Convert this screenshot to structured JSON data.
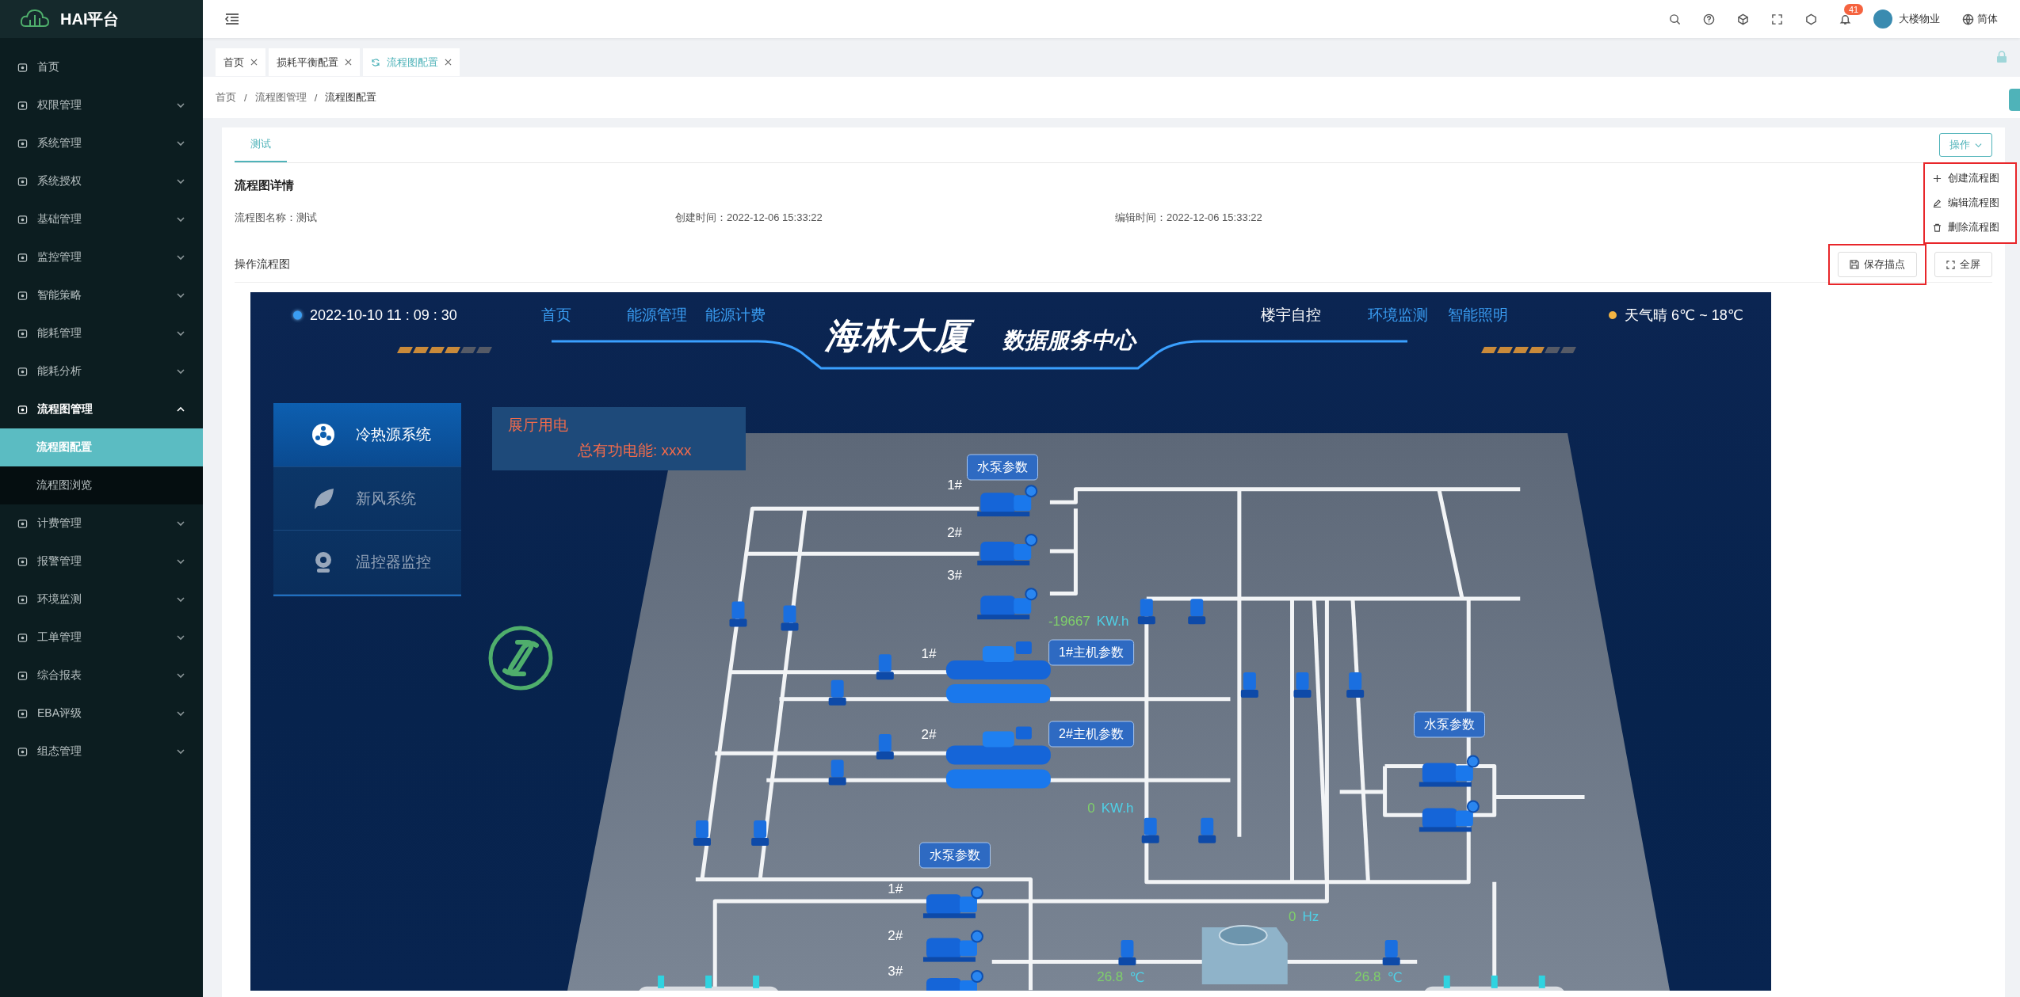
{
  "sidebar": {
    "logo": "HAI平台",
    "items": [
      {
        "label": "首页",
        "kind": "link"
      },
      {
        "label": "权限管理",
        "kind": "group",
        "expanded": false
      },
      {
        "label": "系统管理",
        "kind": "group",
        "expanded": false
      },
      {
        "label": "系统授权",
        "kind": "group",
        "expanded": false
      },
      {
        "label": "基础管理",
        "kind": "group",
        "expanded": false
      },
      {
        "label": "监控管理",
        "kind": "group",
        "expanded": false
      },
      {
        "label": "智能策略",
        "kind": "group",
        "expanded": false
      },
      {
        "label": "能耗管理",
        "kind": "group",
        "expanded": false
      },
      {
        "label": "能耗分析",
        "kind": "group",
        "expanded": false
      },
      {
        "label": "流程图管理",
        "kind": "group",
        "expanded": true,
        "children": [
          {
            "label": "流程图配置",
            "selected": true
          },
          {
            "label": "流程图浏览",
            "selected": false
          }
        ]
      },
      {
        "label": "计费管理",
        "kind": "group",
        "expanded": false
      },
      {
        "label": "报警管理",
        "kind": "group",
        "expanded": false
      },
      {
        "label": "环境监测",
        "kind": "group",
        "expanded": false
      },
      {
        "label": "工单管理",
        "kind": "group",
        "expanded": false
      },
      {
        "label": "综合报表",
        "kind": "group",
        "expanded": false
      },
      {
        "label": "EBA评级",
        "kind": "group",
        "expanded": false
      },
      {
        "label": "组态管理",
        "kind": "group",
        "expanded": false
      }
    ]
  },
  "topbar": {
    "notifications": "41",
    "user": "大楼物业",
    "language": "简体"
  },
  "tabs": [
    {
      "label": "首页",
      "selected": false
    },
    {
      "label": "损耗平衡配置",
      "selected": false
    },
    {
      "label": "流程图配置",
      "selected": true
    }
  ],
  "breadcrumb": {
    "separator": "/",
    "items": [
      "首页",
      "流程图管理",
      "流程图配置"
    ]
  },
  "card": {
    "tabs": [
      {
        "label": "测试",
        "selected": true
      }
    ],
    "action_button": "操作",
    "menu": {
      "highlighted": true,
      "items": [
        {
          "label": "创建流程图",
          "kind": "create"
        },
        {
          "label": "编辑流程图",
          "kind": "edit"
        },
        {
          "label": "删除流程图",
          "kind": "delete"
        }
      ]
    },
    "detail_title": "流程图详情",
    "fields": [
      {
        "label": "流程图名称：",
        "value": "测试"
      },
      {
        "label": "创建时间：",
        "value": "2022-12-06 15:33:22"
      },
      {
        "label": "编辑时间：",
        "value": "2022-12-06 15:33:22"
      }
    ],
    "section_title": "操作流程图",
    "save_button": {
      "label": "保存描点",
      "highlighted": true
    },
    "fullscreen_button": "全屏"
  },
  "diagram": {
    "datetime": "2022-10-10  11 : 09 : 30",
    "nav_left": [
      {
        "label": "首页",
        "selected": false
      },
      {
        "label": "能源管理",
        "selected": false
      },
      {
        "label": "能源计费",
        "selected": false
      }
    ],
    "title": "海林大厦",
    "subtitle": "数据服务中心",
    "nav_right": [
      {
        "label": "楼宇自控",
        "selected": true
      },
      {
        "label": "环境监测",
        "selected": false
      },
      {
        "label": "智能照明",
        "selected": false
      }
    ],
    "weather": "天气晴  6℃ ~ 18℃",
    "systems": [
      {
        "label": "冷热源系统",
        "selected": true
      },
      {
        "label": "新风系统",
        "selected": false
      },
      {
        "label": "温控器监控",
        "selected": false
      }
    ],
    "info_box": {
      "title": "展厅用电",
      "line": "总有功电能: xxxx"
    },
    "param_buttons": [
      "水泵参数",
      "1#主机参数",
      "2#主机参数",
      "水泵参数",
      "水泵参数"
    ],
    "unit_numbers": [
      "1#",
      "2#",
      "3#",
      "1#",
      "2#",
      "1#",
      "2#",
      "3#"
    ],
    "readings": [
      {
        "value": "-19667",
        "unit": "KW.h"
      },
      {
        "value": "0",
        "unit": "KW.h"
      },
      {
        "value": "0",
        "unit": "Hz"
      },
      {
        "value": "26.8",
        "unit": "℃"
      },
      {
        "value": "26.8",
        "unit": "℃"
      }
    ]
  }
}
